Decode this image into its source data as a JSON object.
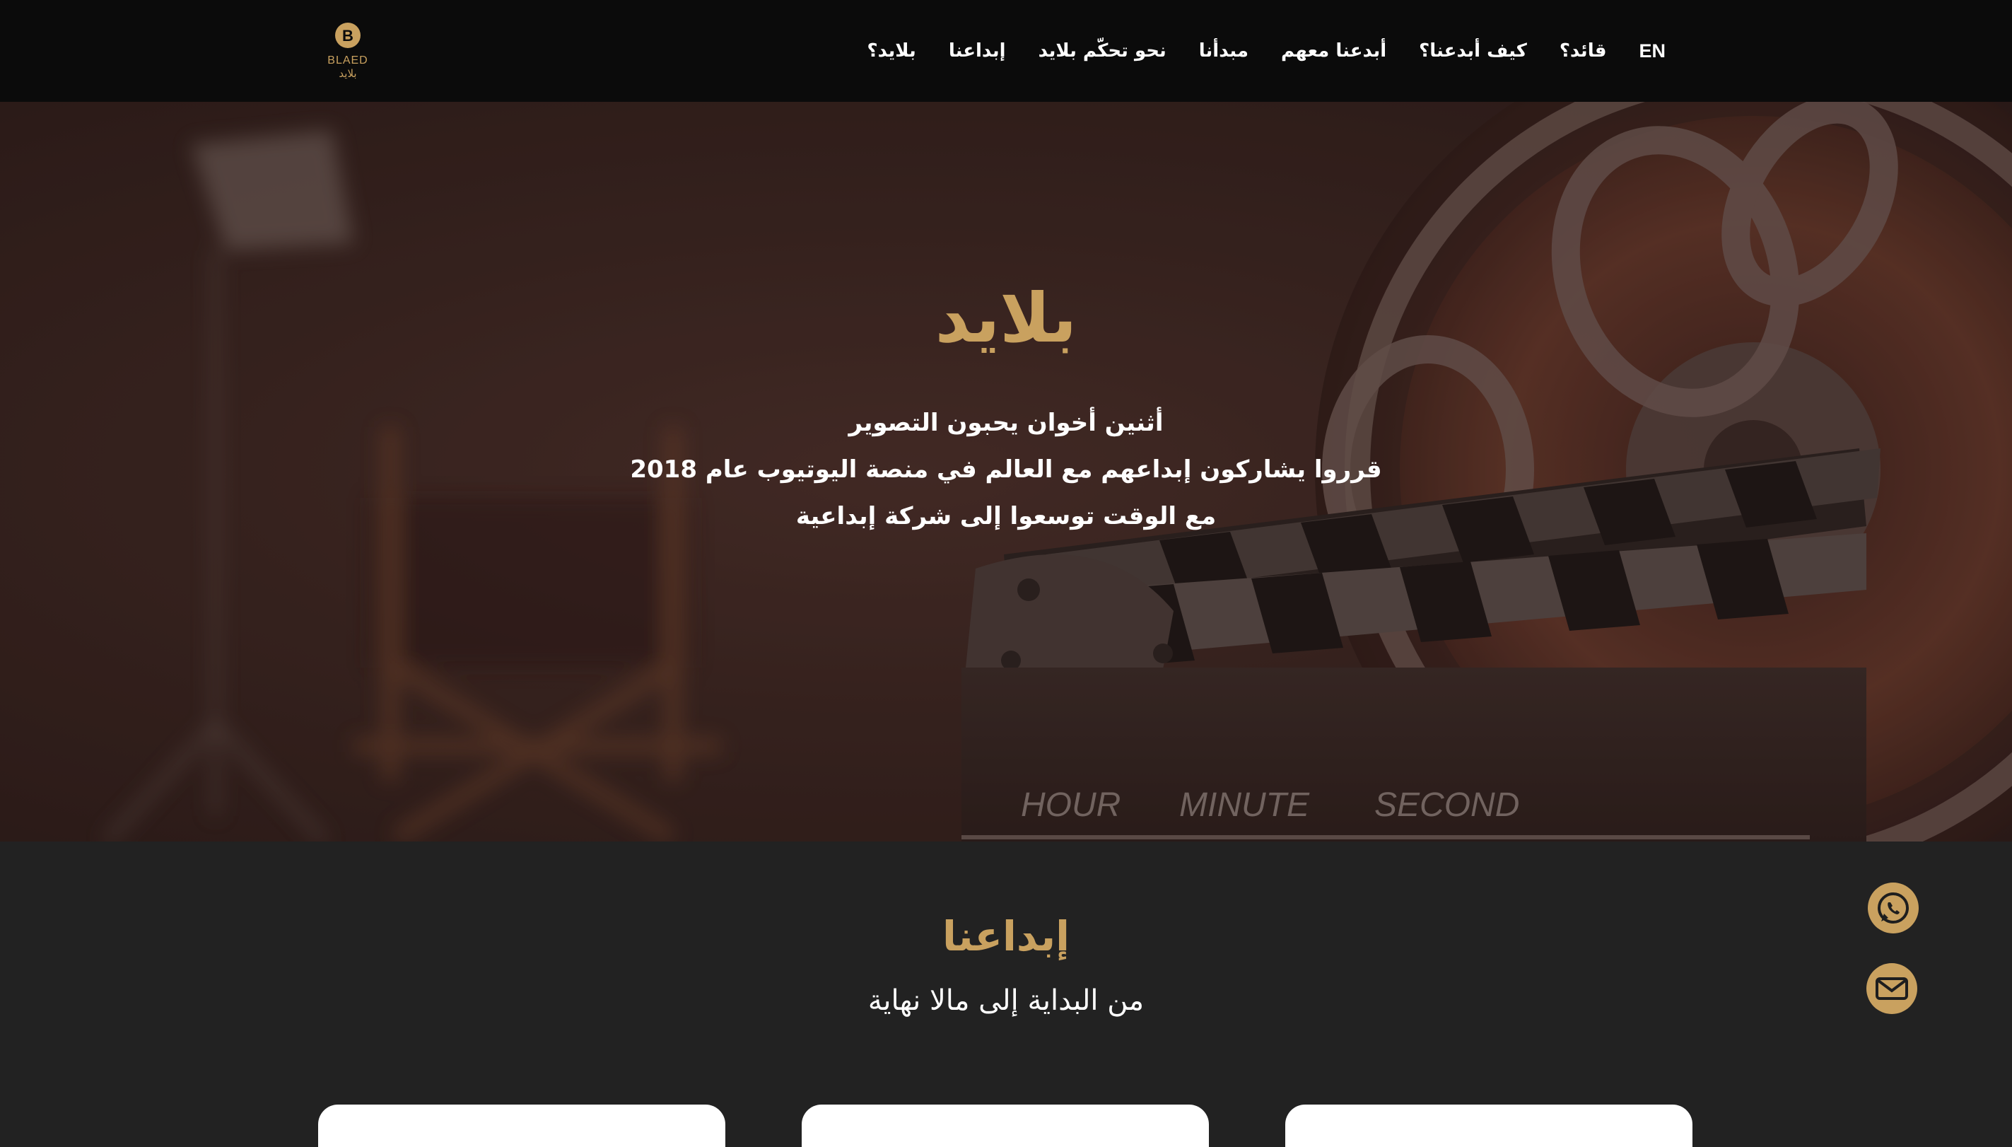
{
  "brand": {
    "logo_icon": "blaed-logo",
    "logo_text_latin": "BLAED",
    "logo_text_arabic": "بلايد"
  },
  "nav": {
    "items": [
      {
        "label": "بلايد؟"
      },
      {
        "label": "إبداعنا"
      },
      {
        "label": "نحو تحكّم بلايد"
      },
      {
        "label": "مبدأنا"
      },
      {
        "label": "أبدعنا معهم"
      },
      {
        "label": "كيف أبدعنا؟"
      },
      {
        "label": "قائد؟"
      }
    ],
    "language_toggle": "EN"
  },
  "hero": {
    "title": "بلايد",
    "lines": [
      "أثنين أخوان يحبون التصوير",
      "قرروا يشاركون إبداعهم مع العالم في منصة اليوتيوب عام 2018",
      "مع الوقت توسعوا إلى شركة إبداعية"
    ],
    "clapper_labels": [
      "HOUR",
      "MINUTE",
      "SECOND"
    ]
  },
  "section": {
    "title": "إبداعنا",
    "subtitle": "من البداية إلى مالا نهاية"
  },
  "floating": {
    "whatsapp_icon": "whatsapp-icon",
    "email_icon": "mail-icon"
  },
  "colors": {
    "accent_gold": "#c9a15f",
    "nav_bg": "#0b0b0b",
    "section_bg": "#222222"
  }
}
